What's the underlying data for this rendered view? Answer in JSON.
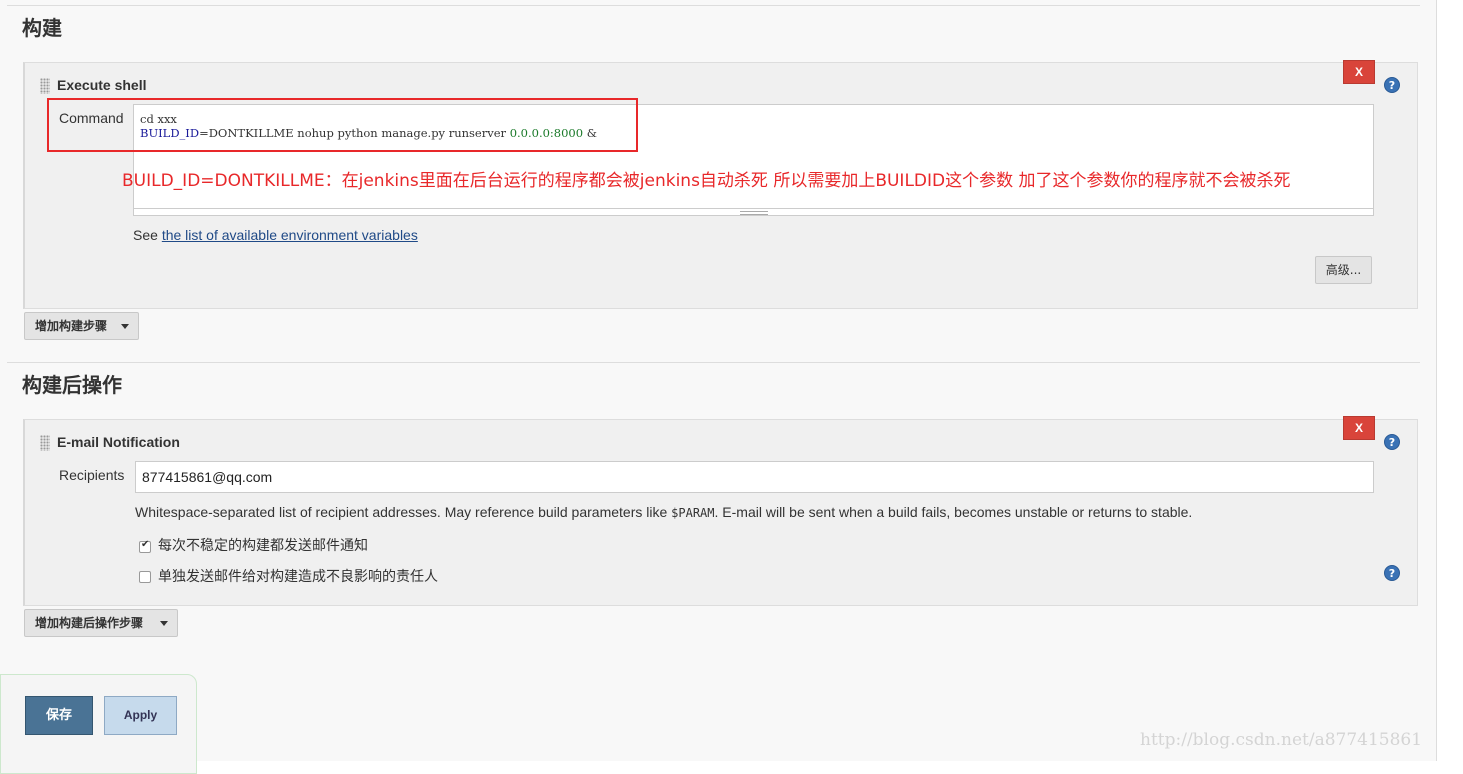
{
  "build_section": {
    "title": "构建",
    "step": {
      "title": "Execute shell",
      "delete_label": "X",
      "help_label": "?",
      "command_label": "Command",
      "command_lines": {
        "line1": "cd xxx",
        "line2_kw": "BUILD_ID",
        "line2_mid": "=DONTKILLME nohup python manage.py runserver ",
        "line2_num": "0.0.0.0:8000",
        "line2_end": " &"
      },
      "annotation": "BUILD_ID=DONTKILLME：在jenkins里面在后台运行的程序都会被jenkins自动杀死  所以需要加上BUILDID这个参数 加了这个参数你的程序就不会被杀死",
      "env_prefix": "See ",
      "env_link": "the list of available environment variables",
      "advanced_label": "高级..."
    },
    "add_step_label": "增加构建步骤"
  },
  "post_build_section": {
    "title": "构建后操作",
    "step": {
      "title": "E-mail Notification",
      "delete_label": "X",
      "help_label": "?",
      "recipients_label": "Recipients",
      "recipients_value": "877415861@qq.com",
      "desc_before": "Whitespace-separated list of recipient addresses. May reference build parameters like ",
      "desc_code": "$PARAM",
      "desc_after": ". E-mail will be sent when a build fails, becomes unstable or returns to stable.",
      "checkbox1_label": "每次不稳定的构建都发送邮件通知",
      "checkbox1_checked": true,
      "checkbox2_label": "单独发送邮件给对构建造成不良影响的责任人",
      "checkbox2_checked": false
    },
    "add_step_label": "增加构建后操作步骤"
  },
  "footer": {
    "save_label": "保存",
    "apply_label": "Apply"
  },
  "watermark": "http://blog.csdn.net/a877415861",
  "colors": {
    "delete_button": "#d9443a",
    "save_button": "#4a7395",
    "annotation": "#e8282a",
    "link": "#204a87"
  }
}
